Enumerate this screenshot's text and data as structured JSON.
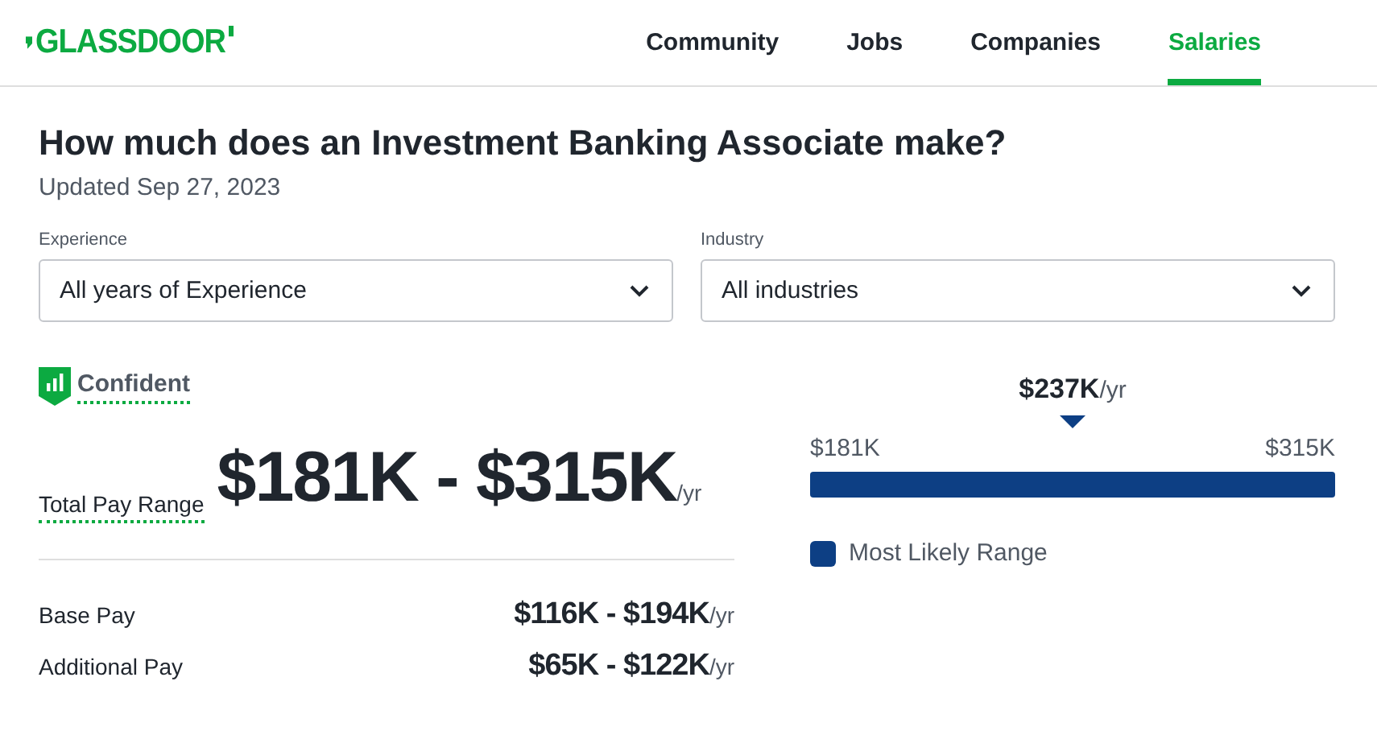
{
  "logo": "GLASSDOOR",
  "nav": [
    {
      "label": "Community",
      "selected": false
    },
    {
      "label": "Jobs",
      "selected": false
    },
    {
      "label": "Companies",
      "selected": false
    },
    {
      "label": "Salaries",
      "selected": true
    }
  ],
  "title": "How much does an Investment Banking Associate make?",
  "updated": "Updated Sep 27, 2023",
  "filters": [
    {
      "label": "Experience",
      "value": "All years of Experience"
    },
    {
      "label": "Industry",
      "value": "All industries"
    }
  ],
  "confidence": "Confident",
  "total": {
    "label": "Total Pay Range",
    "value": "$181K - $315K",
    "unit": "/yr"
  },
  "breakdown": [
    {
      "label": "Base Pay",
      "value": "$116K - $194K",
      "unit": "/yr"
    },
    {
      "label": "Additional Pay",
      "value": "$65K - $122K",
      "unit": "/yr"
    }
  ],
  "range": {
    "median": "$237K",
    "median_unit": "/yr",
    "min": "$181K",
    "max": "$315K",
    "legend": "Most Likely Range"
  }
}
